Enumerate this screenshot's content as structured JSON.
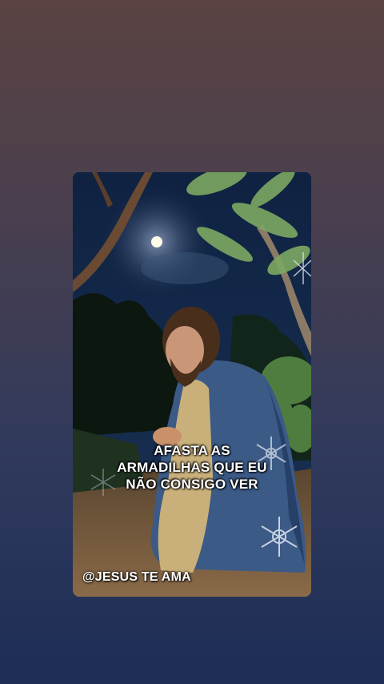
{
  "post": {
    "caption_lines": [
      "AFASTA AS",
      "ARMADILHAS QUE EU",
      "NÃO CONSIGO VER"
    ],
    "watermark": "@JESUS TE AMA"
  },
  "colors": {
    "background_top": "#5a4342",
    "background_bottom": "#1d2d56",
    "sky": "#13264a",
    "robe": "#3b5a86",
    "moon": "#fffbe8"
  },
  "icons": [
    "snowflake-icon",
    "moon-icon"
  ]
}
